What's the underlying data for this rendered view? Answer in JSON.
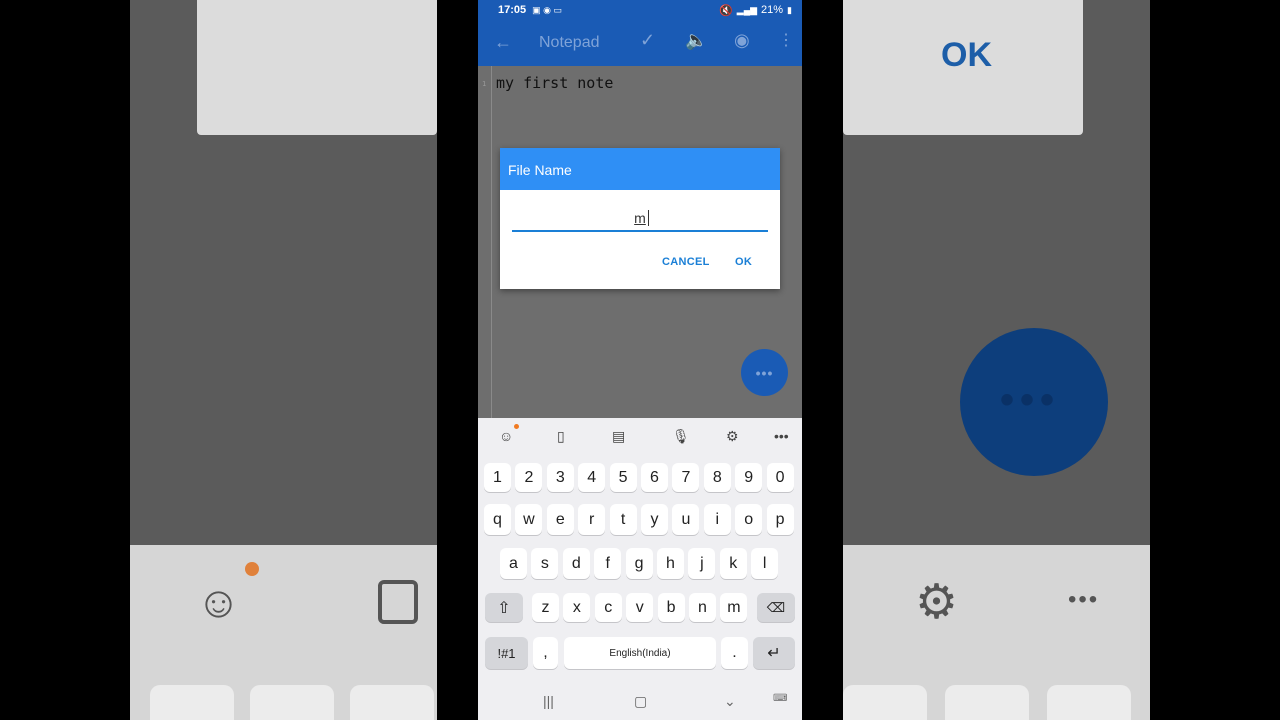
{
  "status": {
    "time": "17:05",
    "battery": "21%"
  },
  "app": {
    "title": "Notepad"
  },
  "editor": {
    "line_number": "1",
    "text": "my first note"
  },
  "dialog": {
    "title": "File Name",
    "value": "m",
    "cancel_label": "CANCEL",
    "ok_label": "OK"
  },
  "keyboard": {
    "row_numbers": [
      "1",
      "2",
      "3",
      "4",
      "5",
      "6",
      "7",
      "8",
      "9",
      "0"
    ],
    "row_1": [
      "q",
      "w",
      "e",
      "r",
      "t",
      "y",
      "u",
      "i",
      "o",
      "p"
    ],
    "row_2": [
      "a",
      "s",
      "d",
      "f",
      "g",
      "h",
      "j",
      "k",
      "l"
    ],
    "row_3": [
      "z",
      "x",
      "c",
      "v",
      "b",
      "n",
      "m"
    ],
    "symbols_label": "!#1",
    "comma_label": ",",
    "space_label": "English(India)",
    "period_label": "."
  },
  "background": {
    "ok_label": "OK"
  },
  "colors": {
    "app_bar": "#1a5bb5",
    "dialog_header": "#2f8ff5",
    "accent": "#1a7fd6"
  }
}
